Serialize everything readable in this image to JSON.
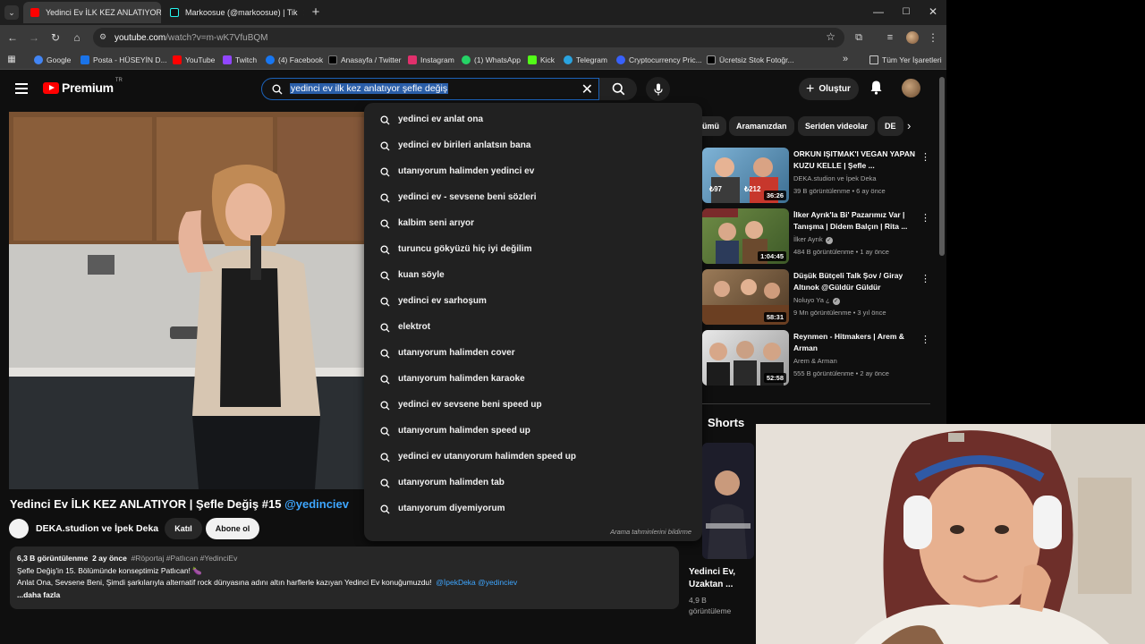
{
  "browser": {
    "tabs": [
      {
        "title": "Yedinci Ev İLK KEZ ANLATIYOR |",
        "active": true
      },
      {
        "title": "Markoosue (@markoosue) | Tik",
        "active": false
      }
    ],
    "url_host": "youtube.com",
    "url_path": "/watch?v=m-wK7VfuBQM",
    "bookmarks": [
      {
        "label": "Google",
        "color": "#4285f4"
      },
      {
        "label": "Posta - HÜSEYİN D...",
        "color": "#1a73e8"
      },
      {
        "label": "YouTube",
        "color": "#ff0000"
      },
      {
        "label": "Twitch",
        "color": "#9146ff"
      },
      {
        "label": "(4) Facebook",
        "color": "#1877f2"
      },
      {
        "label": "Anasayfa / Twitter",
        "color": "#000000"
      },
      {
        "label": "Instagram",
        "color": "#e1306c"
      },
      {
        "label": "(1) WhatsApp",
        "color": "#25d366"
      },
      {
        "label": "Kick",
        "color": "#53fc18"
      },
      {
        "label": "Telegram",
        "color": "#2aa3df"
      },
      {
        "label": "Cryptocurrency Pric...",
        "color": "#3861fb"
      },
      {
        "label": "Ücretsiz Stok Fotoğr...",
        "color": "#000000"
      }
    ],
    "all_bookmarks": "Tüm Yer İşaretleri"
  },
  "youtube": {
    "logo_text": "Premium",
    "logo_region": "TR",
    "search_value": "yedinci ev ilk kez anlatıyor şefle değiş",
    "create_label": "Oluştur",
    "suggestions": [
      "yedinci ev anlat ona",
      "yedinci ev birileri anlatsın bana",
      "utanıyorum halimden yedinci ev",
      "yedinci ev - sevsene beni sözleri",
      "kalbim seni arıyor",
      "turuncu gökyüzü hiç iyi değilim",
      "kuan söyle",
      "yedinci ev sarhoşum",
      "elektrot",
      "utanıyorum halimden cover",
      "utanıyorum halimden karaoke",
      "yedinci ev sevsene beni speed up",
      "utanıyorum halimden speed up",
      "yedinci ev utanıyorum halimden speed up",
      "utanıyorum halimden tab",
      "utanıyorum diyemiyorum"
    ],
    "suggest_footer": "Arama tahminlerini bildirme",
    "video": {
      "title": "Yedinci Ev İLK KEZ ANLATIYOR | Şefle Değiş #15",
      "title_handle": "@yedinciev",
      "channel": "DEKA.studion ve İpek Deka",
      "join_label": "Katıl",
      "subscribe_label": "Abone ol",
      "views": "6,3 B görüntülenme",
      "age": "2 ay önce",
      "tags": "#Röportaj #Patlıcan #YedinciEv",
      "desc_line1": "Şefle Değiş'in 15. Bölümünde konseptimiz Patlıcan! 🍆",
      "desc_line2": "Anlat Ona, Sevsene Beni, Şimdi şarkılarıyla alternatif rock dünyasına adını altın harflerle kazıyan Yedinci Ev konuğumuzdu!",
      "desc_mentions": "@İpekDeka @yedinciev",
      "more_label": "...daha fazla"
    },
    "chips": [
      "ümü",
      "Aramanızdan",
      "Seriden videolar",
      "DE"
    ],
    "recommendations": [
      {
        "title": "ORKUN IŞITMAK'I VEGAN YAPAN KUZU KELLE | Şefle ...",
        "channel": "DEKA.studion ve İpek Deka",
        "verified": false,
        "meta": "39 B görüntülenme • 6 ay önce",
        "duration": "36:26",
        "tint": "#6aa3c8"
      },
      {
        "title": "İlker Ayrık'la Bi' Pazarımız Var | Tanışma | Didem Balçın | Rita ...",
        "channel": "İlker Ayrık",
        "verified": true,
        "meta": "484 B görüntülenme • 1 ay önce",
        "duration": "1:04:45",
        "tint": "#5c7a3a"
      },
      {
        "title": "Düşük Bütçeli Talk Şov / Giray Altınok @Güldür Güldür",
        "channel": "Noluyo Ya ¿",
        "verified": true,
        "meta": "9 Mn görüntülenme • 3 yıl önce",
        "duration": "58:31",
        "tint": "#8a6a4a"
      },
      {
        "title": "Reynmen - Hitmakers | Arem & Arman",
        "channel": "Arem & Arman",
        "verified": false,
        "meta": "555 B görüntülenme • 2 ay önce",
        "duration": "52:58",
        "tint": "#dcdcdc"
      }
    ],
    "shorts": {
      "heading": "Shorts",
      "title_line1": "Yedinci Ev,",
      "title_line2": "Uzaktan ...",
      "meta_line1": "4,9 B",
      "meta_line2": "görüntüleme"
    }
  }
}
